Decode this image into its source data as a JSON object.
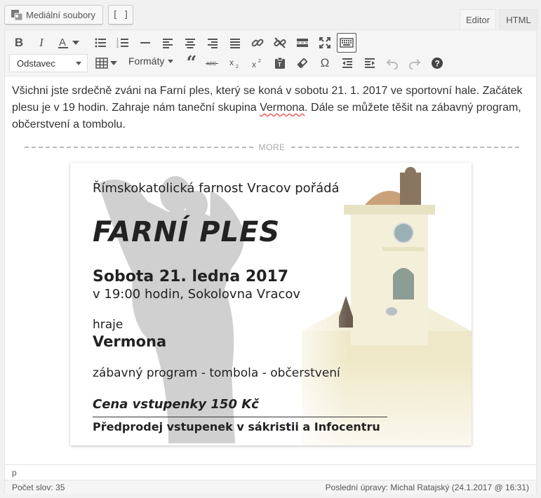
{
  "topbar": {
    "media_button": "Mediální soubory",
    "bracket_button": "[ ]",
    "tabs": [
      {
        "label": "Editor"
      },
      {
        "label": "HTML"
      }
    ]
  },
  "toolbar": {
    "format_select": "Odstavec",
    "formats_label": "Formáty"
  },
  "content": {
    "paragraph_before": "Všichni jste srdečně zváni na Farní ples, který se koná v sobotu 21. 1. 2017 ve sportovní hale. Začátek plesu je v 19 hodin. Zahraje nám taneční skupina ",
    "paragraph_link": "Vermona",
    "paragraph_after": ". Dále se můžete těšit na zábavný program, občerstvení a tombolu.",
    "more_label": "MORE"
  },
  "poster": {
    "organizer": "Římskokatolická farnost Vracov pořádá",
    "title": "FARNÍ PLES",
    "date": "Sobota 21. ledna 2017",
    "time_place": "v 19:00 hodin, Sokolovna Vracov",
    "plays_label": "hraje",
    "band": "Vermona",
    "program": "zábavný program - tombola - občerstvení",
    "price": "Cena vstupenky 150 Kč",
    "presale": "Předprodej vstupenek v sákristii a Infocentru"
  },
  "path": "p",
  "status": {
    "word_count": "Počet slov: 35",
    "last_modified": "Poslední úpravy: Michal Ratajský (24.1.2017 @ 16:31)"
  },
  "colors": {
    "accent": "#0073aa",
    "toolbar_bg": "#f5f5f5",
    "border": "#e5e5e5"
  }
}
